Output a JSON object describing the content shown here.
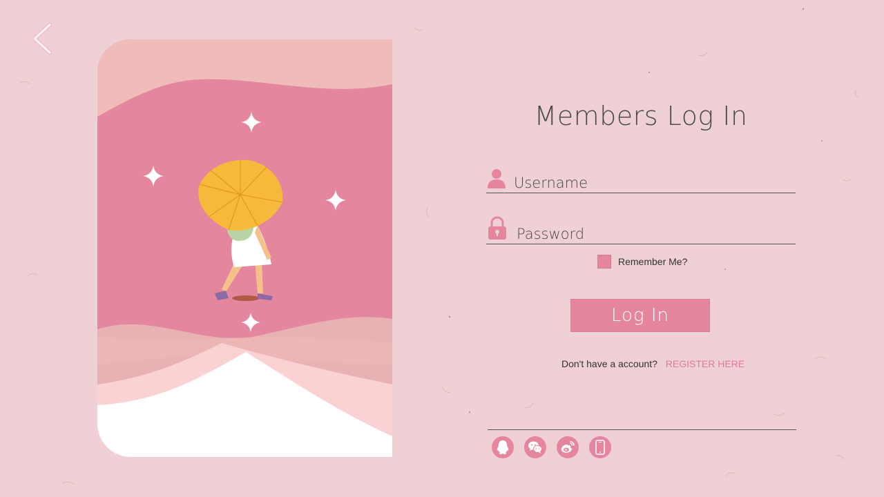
{
  "back_button": {
    "icon": "chevron-left-icon"
  },
  "illustration": {
    "description_icon": "girl-with-umbrella-illustration"
  },
  "login": {
    "title": "Members Log In",
    "username": {
      "label": "Username",
      "icon": "user-icon"
    },
    "password": {
      "label": "Password",
      "icon": "lock-icon"
    },
    "remember_label": "Remember Me?",
    "submit_label": "Log In",
    "signup_prompt": "Don't have a account?",
    "register_label": "REGISTER HERE"
  },
  "social": [
    {
      "icon": "qq-icon"
    },
    {
      "icon": "wechat-icon"
    },
    {
      "icon": "weibo-icon"
    },
    {
      "icon": "phone-icon"
    }
  ],
  "colors": {
    "background": "#efd0d5",
    "accent": "#e6869e",
    "link": "#e27a95",
    "text": "#4b4b4b"
  }
}
